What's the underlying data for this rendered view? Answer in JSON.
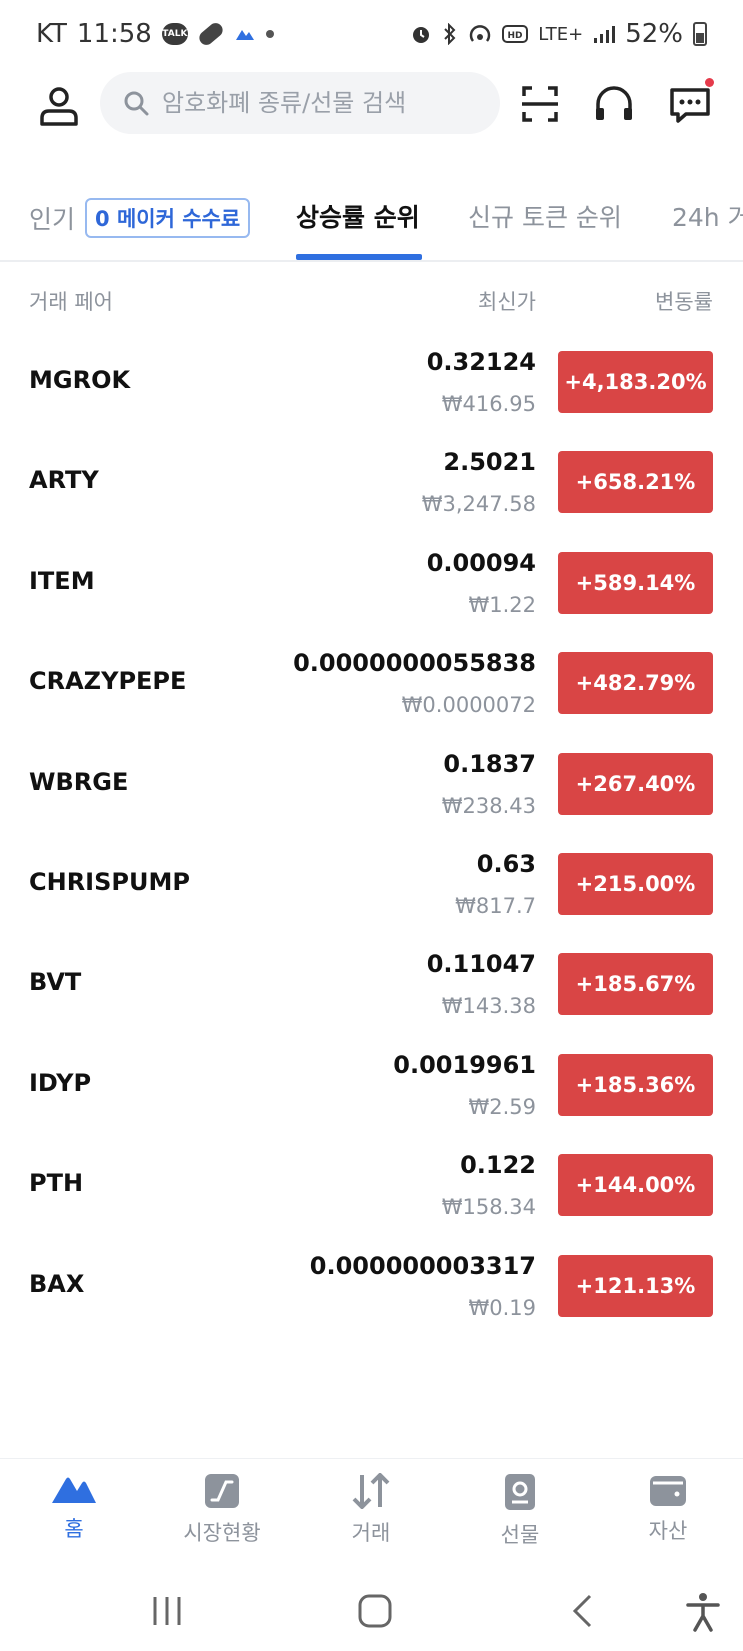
{
  "status_bar": {
    "carrier": "KT",
    "time": "11:58",
    "talk_badge": "TALK",
    "network": "LTE+",
    "battery": "52%"
  },
  "header": {
    "search_placeholder": "암호화폐 종류/선물 검색"
  },
  "tabs": {
    "popular": "인기",
    "maker_badge": "0 메이커 수수료",
    "gainers": "상승률 순위",
    "new_tokens": "신규 토큰 순위",
    "h24": "24h 거"
  },
  "columns": {
    "pair": "거래 페어",
    "price": "최신가",
    "change": "변동률"
  },
  "rows": [
    {
      "pair": "MGROK",
      "price": "0.32124",
      "krw": "₩416.95",
      "change": "+4,183.20%"
    },
    {
      "pair": "ARTY",
      "price": "2.5021",
      "krw": "₩3,247.58",
      "change": "+658.21%"
    },
    {
      "pair": "ITEM",
      "price": "0.00094",
      "krw": "₩1.22",
      "change": "+589.14%"
    },
    {
      "pair": "CRAZYPEPE",
      "price": "0.0000000055838",
      "krw": "₩0.0000072",
      "change": "+482.79%"
    },
    {
      "pair": "WBRGE",
      "price": "0.1837",
      "krw": "₩238.43",
      "change": "+267.40%"
    },
    {
      "pair": "CHRISPUMP",
      "price": "0.63",
      "krw": "₩817.7",
      "change": "+215.00%"
    },
    {
      "pair": "BVT",
      "price": "0.11047",
      "krw": "₩143.38",
      "change": "+185.67%"
    },
    {
      "pair": "IDYP",
      "price": "0.0019961",
      "krw": "₩2.59",
      "change": "+185.36%"
    },
    {
      "pair": "PTH",
      "price": "0.122",
      "krw": "₩158.34",
      "change": "+144.00%"
    },
    {
      "pair": "BAX",
      "price": "0.000000003317",
      "krw": "₩0.19",
      "change": "+121.13%"
    }
  ],
  "bottom_nav": [
    {
      "label": "홈",
      "icon": "home-mountain-icon"
    },
    {
      "label": "시장현황",
      "icon": "market-chart-icon"
    },
    {
      "label": "거래",
      "icon": "trade-arrows-icon"
    },
    {
      "label": "선물",
      "icon": "futures-document-icon"
    },
    {
      "label": "자산",
      "icon": "wallet-icon"
    }
  ],
  "colors": {
    "accent": "#2f6fe0",
    "up_red": "#d94545",
    "muted": "#8d939c",
    "notification_dot": "#e53b4b"
  }
}
